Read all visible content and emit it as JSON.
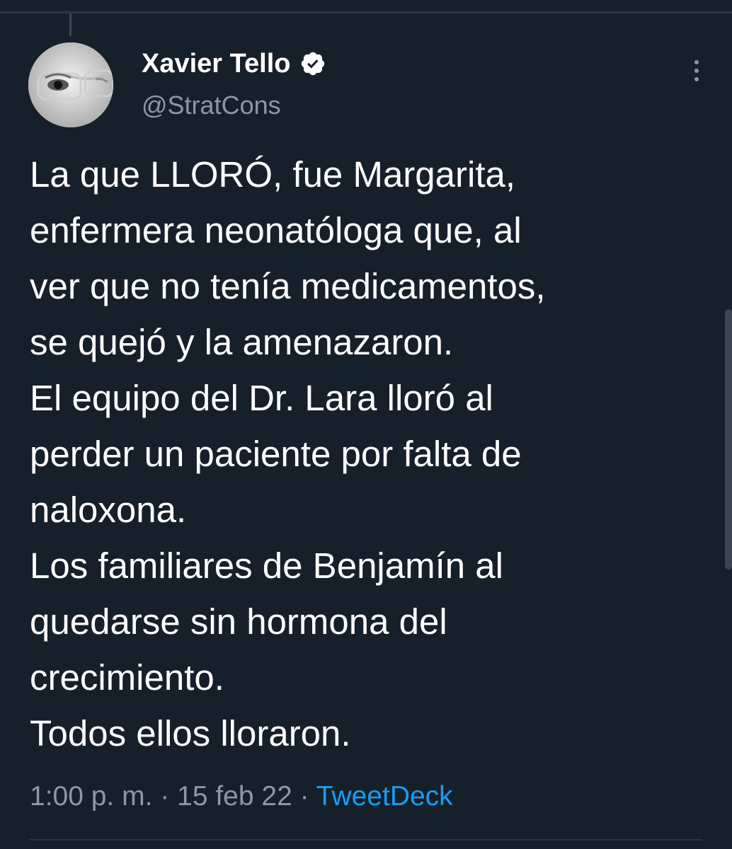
{
  "tweet": {
    "author": {
      "display_name": "Xavier Tello",
      "handle": "@StratCons",
      "verified": true,
      "avatar_icon": "avatar-photo-icon"
    },
    "text_lines": [
      "La que LLORÓ, fue Margarita,",
      "enfermera neonatóloga que, al",
      "ver que no tenía medicamentos,",
      "se quejó y la amenazaron.",
      "El equipo del Dr. Lara lloró al",
      "perder un paciente por falta de",
      "naloxona.",
      "Los familiares de Benjamín al",
      "quedarse sin hormona del",
      "crecimiento.",
      "Todos ellos lloraron."
    ],
    "time": "1:00 p. m.",
    "separator": "·",
    "date": "15 feb 22",
    "source": "TweetDeck"
  },
  "icons": {
    "more": "more-vertical-icon",
    "verified": "verified-badge-icon"
  },
  "colors": {
    "background": "#15202b",
    "text_primary": "#ffffff",
    "text_secondary": "#8b98a5",
    "link": "#1d9bf0"
  }
}
